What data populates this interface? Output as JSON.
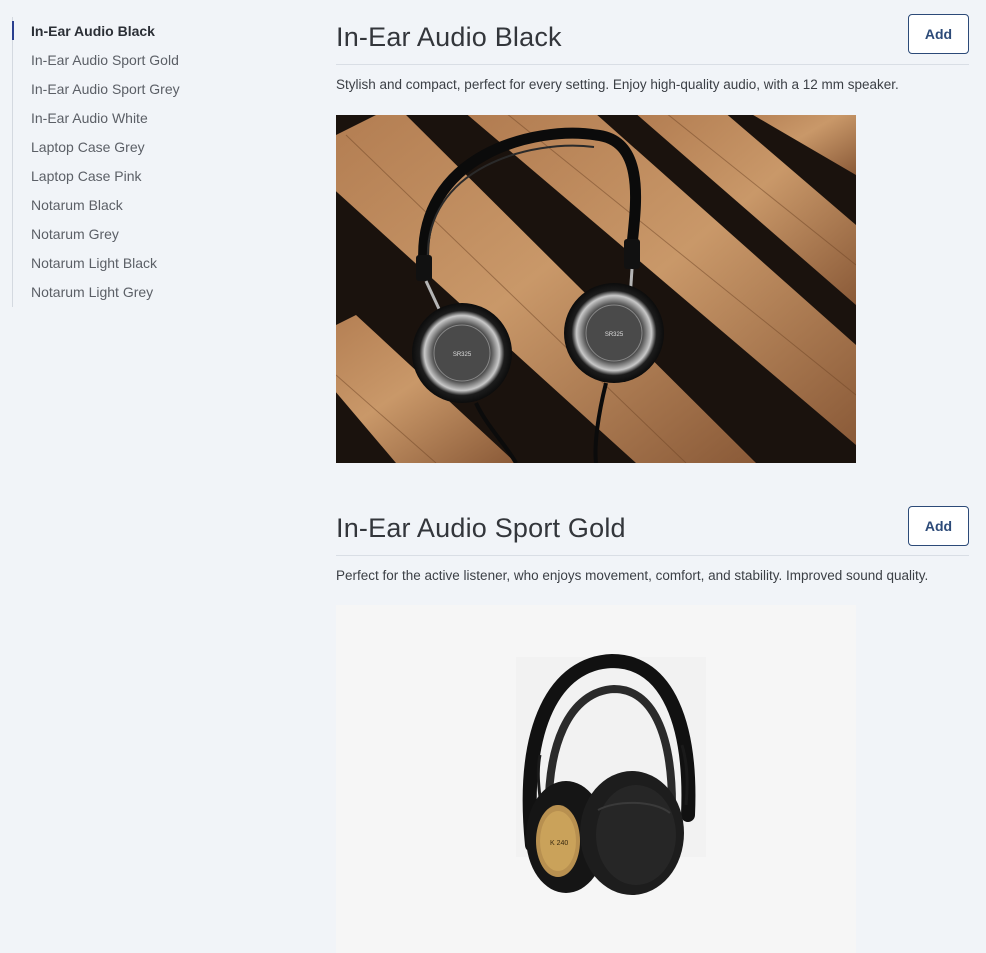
{
  "sidebar": {
    "items": [
      {
        "label": "In-Ear Audio Black",
        "active": true
      },
      {
        "label": "In-Ear Audio Sport Gold",
        "active": false
      },
      {
        "label": "In-Ear Audio Sport Grey",
        "active": false
      },
      {
        "label": "In-Ear Audio White",
        "active": false
      },
      {
        "label": "Laptop Case Grey",
        "active": false
      },
      {
        "label": "Laptop Case Pink",
        "active": false
      },
      {
        "label": "Notarum Black",
        "active": false
      },
      {
        "label": "Notarum Grey",
        "active": false
      },
      {
        "label": "Notarum Light Black",
        "active": false
      },
      {
        "label": "Notarum Light Grey",
        "active": false
      }
    ]
  },
  "products": [
    {
      "title": "In-Ear Audio Black",
      "add_label": "Add",
      "description": "Stylish and compact, perfect for every setting. Enjoy high-quality audio, with a 12 mm speaker.",
      "image_icon": "headphones-on-wood-photo"
    },
    {
      "title": "In-Ear Audio Sport Gold",
      "add_label": "Add",
      "description": "Perfect for the active listener, who enjoys movement, comfort, and stability. Improved sound quality.",
      "image_icon": "studio-headphones-photo"
    }
  ],
  "colors": {
    "background": "#f1f4f8",
    "accent": "#2a3f8f",
    "button_border": "#2c4a78"
  }
}
